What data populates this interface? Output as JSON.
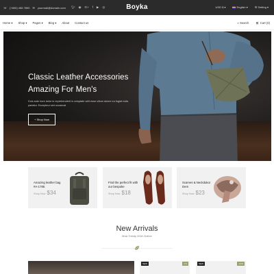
{
  "topbar": {
    "phone": "(+800) 456 7890",
    "email": "yourmail@domain.com",
    "brand": "Boyka",
    "currency": "USD $",
    "language": "English",
    "setting": "Setting"
  },
  "nav": {
    "items": [
      "Home",
      "Shop",
      "Pages",
      "Blog",
      "About",
      "Contact us"
    ],
    "search": "Search",
    "cart": "Cart (0)"
  },
  "hero": {
    "title_line1": "Classic Leather Accessories",
    "title_line2": "Amazing For Men's",
    "body": "Duis aute irure dolor in reprehenderit in voluptate velit esse cillum dolore eu fugiat nulla pariatur. Excepteur sint occaecat",
    "button": "Shop Now"
  },
  "cards": [
    {
      "title": "Amazing leather bag #A-1785",
      "price_label": "Shop Now",
      "price": "$34"
    },
    {
      "title": "Find the perfect fit with our bespoke",
      "price_label": "Shop Now",
      "price": "$18"
    },
    {
      "title": "Scarves & Neckdukor Dem",
      "price_label": "Shop Now",
      "price": "$23"
    }
  ],
  "arrivals": {
    "title": "New Arrivals",
    "subtitle": "Most Trendy 2018 Clother",
    "tag_new": "NEW",
    "tag_off_1": "-7%",
    "tag_off_2": "-10%"
  }
}
